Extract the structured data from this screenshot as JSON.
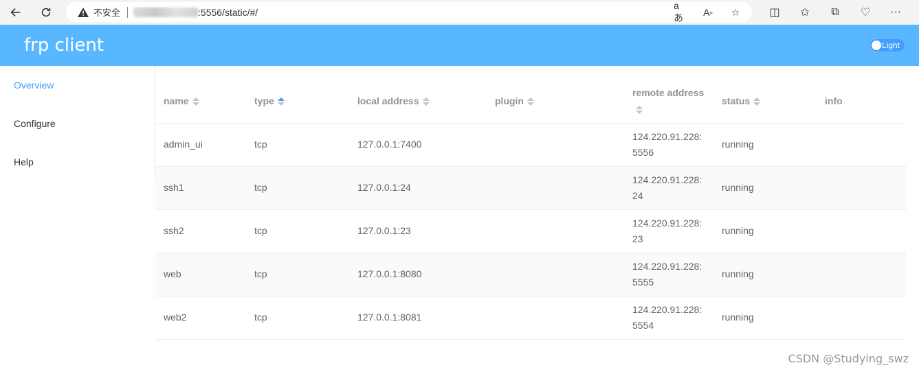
{
  "browser": {
    "insecure_label": "不安全",
    "url_path": ":5556/static/#/"
  },
  "app": {
    "title": "frp client",
    "theme_toggle_label": "Light"
  },
  "sidebar": {
    "items": [
      {
        "label": "Overview",
        "active": true
      },
      {
        "label": "Configure",
        "active": false
      },
      {
        "label": "Help",
        "active": false
      }
    ]
  },
  "table": {
    "headers": [
      "name",
      "type",
      "local address",
      "plugin",
      "remote address",
      "status",
      "info"
    ],
    "rows": [
      {
        "name": "admin_ui",
        "type": "tcp",
        "local": "127.0.0.1:7400",
        "plugin": "",
        "remote": "124.220.91.228:5556",
        "status": "running",
        "info": ""
      },
      {
        "name": "ssh1",
        "type": "tcp",
        "local": "127.0.0.1:24",
        "plugin": "",
        "remote": "124.220.91.228:24",
        "status": "running",
        "info": ""
      },
      {
        "name": "ssh2",
        "type": "tcp",
        "local": "127.0.0.1:23",
        "plugin": "",
        "remote": "124.220.91.228:23",
        "status": "running",
        "info": ""
      },
      {
        "name": "web",
        "type": "tcp",
        "local": "127.0.0.1:8080",
        "plugin": "",
        "remote": "124.220.91.228:5555",
        "status": "running",
        "info": ""
      },
      {
        "name": "web2",
        "type": "tcp",
        "local": "127.0.0.1:8081",
        "plugin": "",
        "remote": "124.220.91.228:5554",
        "status": "running",
        "info": ""
      }
    ]
  },
  "watermark": "CSDN @Studying_swz",
  "colors": {
    "header_bg": "#58b7ff",
    "active_menu": "#409eff"
  }
}
